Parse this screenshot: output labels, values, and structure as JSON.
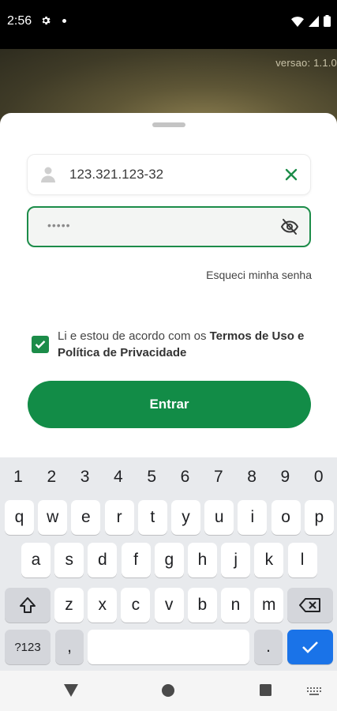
{
  "status_bar": {
    "time": "2:56"
  },
  "hero": {
    "version": "versao: 1.1.0"
  },
  "form": {
    "cpf_value": "123.321.123-32",
    "password_dots": "•••••",
    "forgot_label": "Esqueci minha senha",
    "terms_prefix": "Li e estou de acordo com os ",
    "terms_link": "Termos de Uso e Política de Privacidade",
    "terms_checked": true,
    "submit_label": "Entrar"
  },
  "colors": {
    "primary_green": "#128c47",
    "keyboard_bg": "#e8eaed",
    "enter_blue": "#1a73e8"
  },
  "keyboard": {
    "numbers": [
      "1",
      "2",
      "3",
      "4",
      "5",
      "6",
      "7",
      "8",
      "9",
      "0"
    ],
    "row1": [
      "q",
      "w",
      "e",
      "r",
      "t",
      "y",
      "u",
      "i",
      "o",
      "p"
    ],
    "row2": [
      "a",
      "s",
      "d",
      "f",
      "g",
      "h",
      "j",
      "k",
      "l"
    ],
    "row3": [
      "z",
      "x",
      "c",
      "v",
      "b",
      "n",
      "m"
    ],
    "symbols_label": "?123",
    "comma": ",",
    "period": "."
  }
}
